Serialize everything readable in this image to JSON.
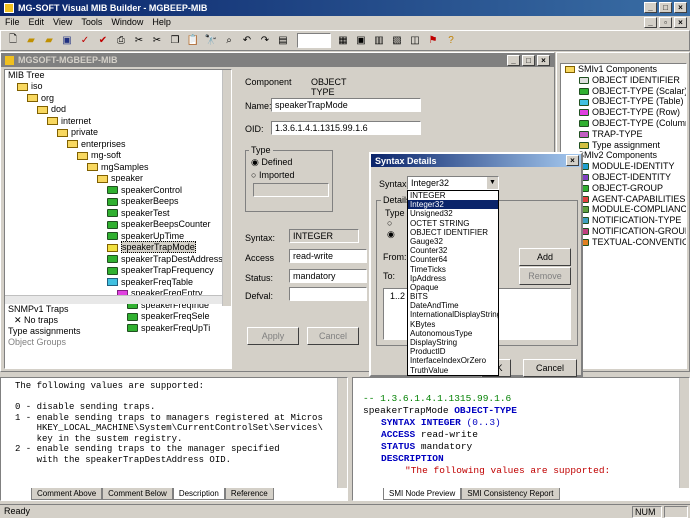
{
  "app": {
    "title": "MG-SOFT Visual MIB Builder - MGBEEP-MIB"
  },
  "menu": [
    "File",
    "Edit",
    "View",
    "Tools",
    "Window",
    "Help"
  ],
  "status": {
    "left": "Ready",
    "right": "NUM"
  },
  "mibwin": {
    "title": "MGSOFT-MGBEEP-MIB"
  },
  "tree": {
    "header": "MIB Tree",
    "items": [
      {
        "label": "iso",
        "indent": 1,
        "icon": "folder"
      },
      {
        "label": "org",
        "indent": 2,
        "icon": "folder"
      },
      {
        "label": "dod",
        "indent": 3,
        "icon": "folder"
      },
      {
        "label": "internet",
        "indent": 4,
        "icon": "folder"
      },
      {
        "label": "private",
        "indent": 5,
        "icon": "folder"
      },
      {
        "label": "enterprises",
        "indent": 6,
        "icon": "folder"
      },
      {
        "label": "mg-soft",
        "indent": 7,
        "icon": "folder"
      },
      {
        "label": "mgSamples",
        "indent": 8,
        "icon": "folder"
      },
      {
        "label": "speaker",
        "indent": 9,
        "icon": "folder"
      },
      {
        "label": "speakerControl",
        "indent": 10,
        "icon": "leaf"
      },
      {
        "label": "speakerBeeps",
        "indent": 10,
        "icon": "leaf"
      },
      {
        "label": "speakerTest",
        "indent": 10,
        "icon": "leaf"
      },
      {
        "label": "speakerBeepsCounter",
        "indent": 10,
        "icon": "leaf"
      },
      {
        "label": "speakerUpTime",
        "indent": 10,
        "icon": "leaf"
      },
      {
        "label": "speakerTrapMode",
        "indent": 10,
        "icon": "sel",
        "selected": true
      },
      {
        "label": "speakerTrapDestAddress",
        "indent": 10,
        "icon": "leaf"
      },
      {
        "label": "speakerTrapFrequency",
        "indent": 10,
        "icon": "leaf"
      },
      {
        "label": "speakerFreqTable",
        "indent": 10,
        "icon": "table"
      },
      {
        "label": "speakerFreqEntry",
        "indent": 11,
        "icon": "entry"
      },
      {
        "label": "speakerFreqInde",
        "indent": 12,
        "icon": "leaf"
      },
      {
        "label": "speakerFreqSele",
        "indent": 12,
        "icon": "leaf"
      },
      {
        "label": "speakerFreqUpTi",
        "indent": 12,
        "icon": "leaf"
      }
    ],
    "traps_header": "SNMPv1 Traps",
    "no_traps": "No traps",
    "type_assign": "Type assignments",
    "obj_groups": "Object Groups"
  },
  "component": {
    "component_label": "Component",
    "component_value": "OBJECT TYPE",
    "name_label": "Name:",
    "name_value": "speakerTrapMode",
    "oid_label": "OID:",
    "oid_value": "1.3.6.1.4.1.1315.99.1.6",
    "type_group": "Type",
    "defined": "Defined",
    "imported": "Imported",
    "syntax_label": "Syntax:",
    "syntax_value": "INTEGER",
    "access_label": "Access",
    "access_value": "read-write",
    "status_label": "Status:",
    "status_value": "mandatory",
    "defval_label": "Defval:",
    "apply": "Apply",
    "cancel": "Cancel"
  },
  "syntax_dialog": {
    "title": "Syntax Details",
    "syntax_label": "Syntax:",
    "syntax_value": "Integer32",
    "details_label": "Details",
    "type_label": "Type",
    "from_label": "From:",
    "to_label": "To:",
    "range_row": "1..2",
    "add": "Add",
    "remove": "Remove",
    "cancel": "Cancel",
    "ok": "OK",
    "options": [
      "INTEGER",
      "Integer32",
      "Unsigned32",
      "OCTET STRING",
      "OBJECT IDENTIFIER",
      "Gauge32",
      "Counter32",
      "Counter64",
      "TimeTicks",
      "IpAddress",
      "Opaque",
      "BITS",
      "DateAndTime",
      "InternationalDisplayString",
      "KBytes",
      "AutonomousType",
      "DisplayString",
      "ProductID",
      "InterfaceIndexOrZero",
      "TruthValue"
    ],
    "selected_index": 1
  },
  "smi": {
    "v1_header": "SMIv1 Components",
    "v1": [
      "OBJECT IDENTIFIER",
      "OBJECT-TYPE (Scalar)",
      "OBJECT-TYPE (Table)",
      "OBJECT-TYPE (Row)",
      "OBJECT-TYPE (Columna",
      "TRAP-TYPE",
      "Type assignment"
    ],
    "v2_header": "SMIv2 Components",
    "v2": [
      "MODULE-IDENTITY",
      "OBJECT-IDENTITY",
      "OBJECT-GROUP",
      "AGENT-CAPABILITIES",
      "MODULE-COMPLIANCE",
      "NOTIFICATION-TYPE",
      "NOTIFICATION-GROUP",
      "TEXTUAL-CONVENTION"
    ]
  },
  "description": {
    "lines": [
      "The following values are supported:",
      "",
      "0 - disable sending traps.",
      "1 - enable sending traps to managers registered at Micros",
      "    HKEY_LOCAL_MACHINE\\System\\CurrentControlSet\\Services\\",
      "    key in the sustem registry.",
      "2 - enable sending traps to the manager specified",
      "    with the speakerTrapDestAddress OID."
    ],
    "tabs": [
      "Comment Above",
      "Comment Below",
      "Description",
      "Reference"
    ],
    "active_tab": 2
  },
  "preview": {
    "oid_comment": "-- 1.3.6.1.4.1.1315.99.1.6",
    "name": "speakerTrapMode",
    "kw_objtype": "OBJECT-TYPE",
    "kw_syntax": "SYNTAX",
    "syntax_type": "INTEGER",
    "syntax_range": "(0..3)",
    "kw_access": "ACCESS",
    "access_val": "read-write",
    "kw_status": "STATUS",
    "status_val": "mandatory",
    "kw_desc": "DESCRIPTION",
    "desc_text": "\"The following values are supported:",
    "tabs": [
      "SMI Node Preview",
      "SMI Consistency Report"
    ]
  }
}
